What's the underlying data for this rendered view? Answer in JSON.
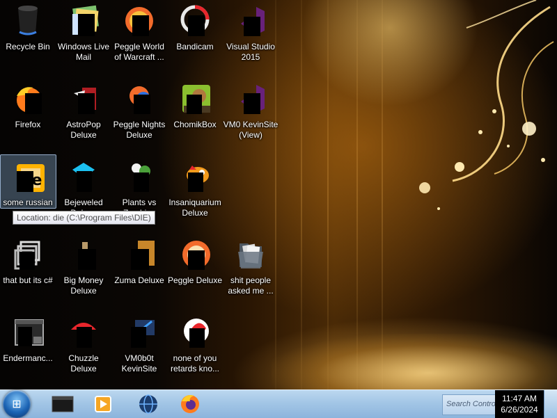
{
  "desktop": {
    "icons": [
      {
        "label": "Recycle Bin",
        "icon": "recycle-bin-icon"
      },
      {
        "label": "Windows Live\nMail",
        "icon": "windows-live-mail-icon"
      },
      {
        "label": "Peggle World\nof Warcraft ...",
        "icon": "peggle-world-of-warcraft-icon"
      },
      {
        "label": "Bandicam",
        "icon": "bandicam-icon"
      },
      {
        "label": "Visual Studio\n2015",
        "icon": "visual-studio-icon"
      },
      {
        "label": "Firefox",
        "icon": "firefox-icon"
      },
      {
        "label": "AstroPop\nDeluxe",
        "icon": "astropop-icon"
      },
      {
        "label": "Peggle Nights\nDeluxe",
        "icon": "peggle-nights-icon"
      },
      {
        "label": "ChomikBox",
        "icon": "chomikbox-icon"
      },
      {
        "label": "VM0 KevinSite\n(View)",
        "icon": "visual-studio-icon"
      },
      {
        "label": "some russian",
        "icon": "die-icon"
      },
      {
        "label": "Bejeweled\nDeluxe",
        "icon": "bejeweled-icon"
      },
      {
        "label": "Plants vs\nZombies",
        "icon": "plants-vs-zombies-icon"
      },
      {
        "label": "Insaniquarium\nDeluxe",
        "icon": "insaniquarium-icon"
      },
      {
        "label": "that but its c#",
        "icon": "shortcut-icon"
      },
      {
        "label": "Big Money\nDeluxe",
        "icon": "big-money-icon"
      },
      {
        "label": "Zuma Deluxe",
        "icon": "zuma-icon"
      },
      {
        "label": "Peggle Deluxe",
        "icon": "peggle-deluxe-icon"
      },
      {
        "label": "shit people\nasked me ...",
        "icon": "folder-icon"
      },
      {
        "label": "Endermanc...",
        "icon": "app-window-icon"
      },
      {
        "label": "Chuzzle\nDeluxe",
        "icon": "chuzzle-icon"
      },
      {
        "label": "VM0b0t\nKevinSite",
        "icon": "vm-shortcut-icon"
      },
      {
        "label": "none of you\nretards kno...",
        "icon": "pdf-shortcut-icon"
      }
    ],
    "tooltip": "Location: die (C:\\Program Files\\DIE)"
  },
  "taskbar": {
    "start": {
      "icon": "windows-orb-icon",
      "glyph": "⊞"
    },
    "pinned": [
      {
        "icon": "terminal-icon"
      },
      {
        "icon": "media-player-icon"
      },
      {
        "icon": "globe-browser-icon"
      },
      {
        "icon": "firefox-icon"
      }
    ],
    "search_text": "Search Control...",
    "clock": {
      "time": "11:47 AM",
      "date": "6/26/2024"
    }
  }
}
